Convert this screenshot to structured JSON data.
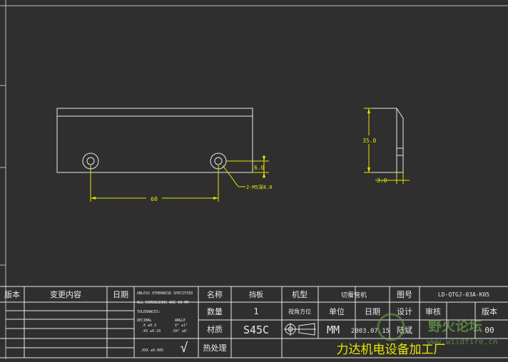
{
  "drawing": {
    "front_view": {
      "dim_length": "60",
      "dim_height": "6.0",
      "hole_callout": "2-M5深8.0"
    },
    "side_view": {
      "dim_height": "35.0",
      "dim_width": "3.0"
    }
  },
  "title_block": {
    "revision": {
      "col_version": "版本",
      "col_change": "变更内容",
      "col_date": "日期"
    },
    "tolerance_note": {
      "line1": "UNLESS OTHERWISE SPECIFIED",
      "line2": "ALL DIMENSIONS ARE IN MM",
      "line3": "TOLERANCES:",
      "line4a": "DECIMAL",
      "line4b": "ANGLE",
      "line5a": ".X ±0.3",
      "line5b": "X° ±1°",
      "line6a": ".XX ±0.10",
      "line6b": ".XX° ±6'",
      "line7a": ".XXX ±0.005",
      "check": "√"
    },
    "labels": {
      "name": "名称",
      "qty": "数量",
      "material": "材质",
      "heat": "热处理",
      "model": "机型",
      "view_dir": "视角方位",
      "unit": "单位",
      "date": "日期",
      "drawing_no": "图号",
      "design": "设计",
      "review": "审核",
      "version": "版本"
    },
    "values": {
      "name": "挡板",
      "qty": "1",
      "material": "S45C",
      "heat": "",
      "model": "切蚕管机",
      "unit": "MM",
      "date": "2003.07.15",
      "designer": "陆斌",
      "drawing_no": "LD-QTGJ-03A-K05",
      "version": "00",
      "company": "力达机电设备加工厂"
    }
  },
  "watermark": {
    "text": "野火论坛",
    "url": "www.wildfire.cn"
  },
  "colors": {
    "background": "#2f2f2f",
    "outline": "#e8e8e8",
    "dimension": "#e6e600"
  }
}
